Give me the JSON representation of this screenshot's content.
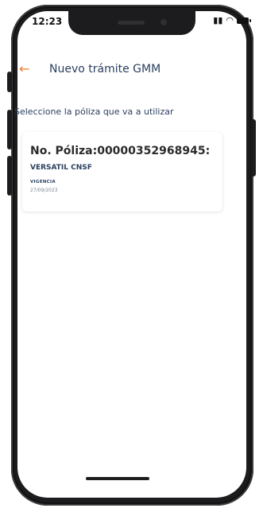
{
  "status_bar": {
    "time": "12:23",
    "signal_icon": "signal-icon",
    "wifi_icon": "wifi-icon",
    "battery_icon": "battery-icon"
  },
  "header": {
    "back_icon": "back-arrow-icon",
    "title": "Nuevo trámite GMM"
  },
  "instruction": "Seleccione la póliza que va a utilizar",
  "policy_card": {
    "policy_number": "No. Póliza:00000352968945:",
    "product": "VERSATIL CNSF",
    "validity_label": "VIGENCIA",
    "validity_date": "27/09/2023"
  },
  "colors": {
    "accent": "#f07a2a",
    "title_text": "#2a3f5f"
  }
}
